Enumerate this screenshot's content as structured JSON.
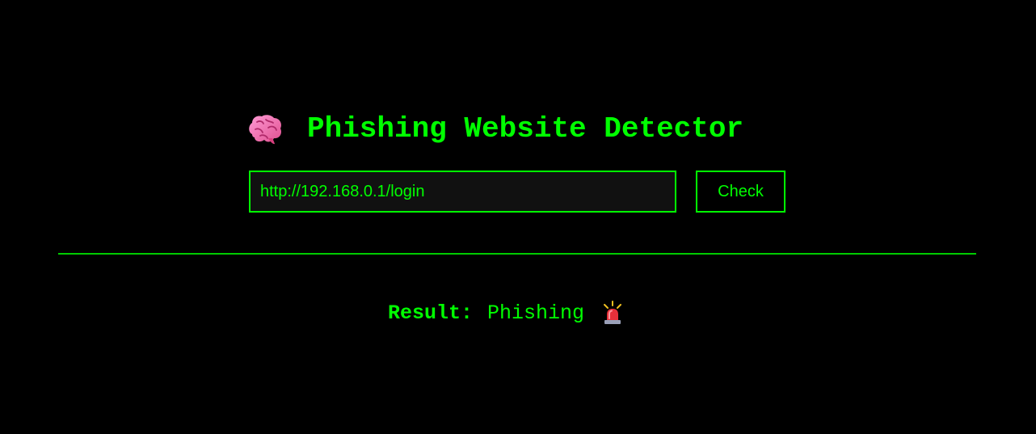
{
  "header": {
    "icon": "brain-icon",
    "title": "Phishing Website Detector"
  },
  "form": {
    "url_value": "http://192.168.0.1/login",
    "check_label": "Check"
  },
  "result": {
    "label": "Result:",
    "value": "Phishing",
    "icon": "police-siren-icon"
  },
  "colors": {
    "background": "#000000",
    "accent": "#00ff00",
    "input_background": "#111111"
  }
}
